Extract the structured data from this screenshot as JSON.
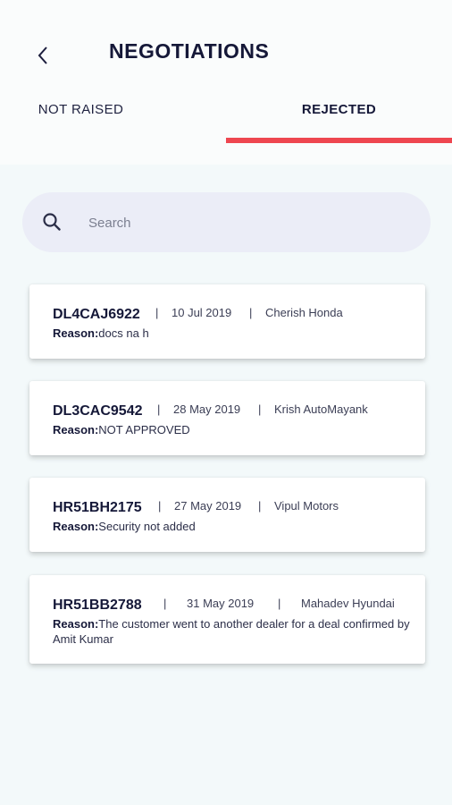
{
  "header": {
    "title": "NEGOTIATIONS"
  },
  "tabs": [
    {
      "label": "NOT RAISED",
      "active": false
    },
    {
      "label": "REJECTED",
      "active": true
    }
  ],
  "search": {
    "placeholder": "Search"
  },
  "colors": {
    "accent": "#ee4650",
    "primary_text": "#151838",
    "background": "#f3f9fa",
    "search_bg": "#ebedf7"
  },
  "icons": {
    "back": "chevron-left-icon",
    "search": "search-icon"
  },
  "reason_label": "Reason:",
  "separator": "|",
  "items": [
    {
      "reg": "DL4CAJ6922",
      "date": "10 Jul 2019",
      "dealer": "Cherish Honda",
      "reason": "docs na h"
    },
    {
      "reg": "DL3CAC9542",
      "date": "28 May 2019",
      "dealer": "Krish AutoMayank",
      "reason": "NOT APPROVED"
    },
    {
      "reg": "HR51BH2175",
      "date": "27 May 2019",
      "dealer": "Vipul Motors",
      "reason": "Security not added"
    },
    {
      "reg": "HR51BB2788",
      "date": "31 May 2019",
      "dealer": "Mahadev Hyundai",
      "reason": "The customer went to another dealer for a deal confirmed by Amit Kumar"
    }
  ]
}
